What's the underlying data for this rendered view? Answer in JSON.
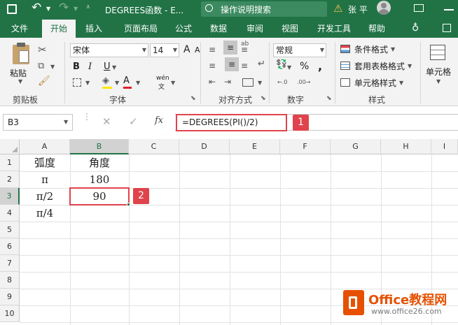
{
  "window": {
    "title": "DEGREES函数 - E...",
    "search_placeholder": "操作说明搜索",
    "user": "张 平",
    "warning_icon": "warning-icon"
  },
  "tabs": [
    "文件",
    "开始",
    "插入",
    "页面布局",
    "公式",
    "数据",
    "审阅",
    "视图",
    "开发工具",
    "帮助"
  ],
  "active_tab": "开始",
  "ribbon": {
    "clipboard": {
      "paste_label": "粘贴",
      "group_label": "剪贴板"
    },
    "font": {
      "font_name": "宋体",
      "font_size": "14",
      "bold": "B",
      "italic": "I",
      "underline": "U",
      "increase": "A",
      "decrease": "A",
      "phonetic": "wén",
      "group_label": "字体"
    },
    "alignment": {
      "group_label": "对齐方式"
    },
    "number": {
      "format": "常规",
      "percent": "%",
      "comma": ",",
      "group_label": "数字"
    },
    "styles": {
      "conditional": "条件格式",
      "table": "套用表格格式",
      "cell_styles": "单元格样式",
      "group_label": "样式"
    },
    "cells": {
      "label": "单元格"
    }
  },
  "formula_bar": {
    "name_box": "B3",
    "fx": "fx",
    "formula": "=DEGREES(PI()/2)"
  },
  "columns": [
    "A",
    "B",
    "C",
    "D",
    "E",
    "F",
    "G",
    "H",
    "I"
  ],
  "rows": [
    "1",
    "2",
    "3",
    "4",
    "5",
    "6",
    "7",
    "8",
    "9",
    "10"
  ],
  "cells": {
    "A1": "弧度",
    "B1": "角度",
    "A2": "π",
    "B2": "180",
    "A3": "π/2",
    "B3": "90",
    "A4": "π/4"
  },
  "badges": {
    "one": "1",
    "two": "2"
  },
  "watermark": {
    "brand": "Office教程网",
    "url": "www.office26.com"
  },
  "colors": {
    "excel_green": "#217346",
    "badge_red": "#e0434b",
    "selection_green": "#217346"
  }
}
